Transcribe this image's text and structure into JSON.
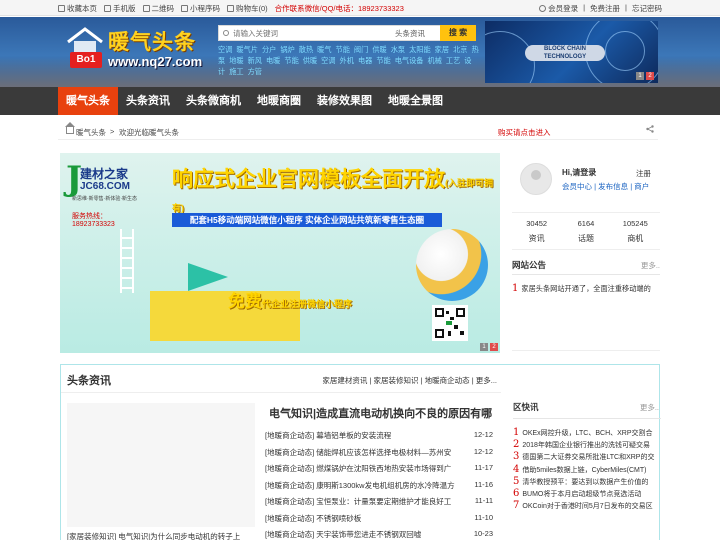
{
  "topbar": {
    "left": [
      "收藏本页",
      "手机版",
      "二维码",
      "小程序码",
      "购物车(0)"
    ],
    "hot": "合作联系微信/QQ/电话：18923733323",
    "right": [
      "会员登录",
      "免费注册",
      "忘记密码"
    ]
  },
  "header": {
    "logo_title": "暖气头条",
    "logo_badge": "Bo1",
    "logo_url": "www.nq27.com",
    "search_placeholder": "请输入关键词",
    "search_scope": "头条资讯",
    "search_button": "搜 索",
    "hot_words": [
      "空调",
      "暖气片",
      "分户",
      "锅炉",
      "散热",
      "暖气",
      "节能",
      "阀门",
      "供暖",
      "水泵",
      "太阳能",
      "家居",
      "北京",
      "热泵",
      "地暖",
      "新风",
      "电暖",
      "节能",
      "供暖",
      "空调",
      "外机",
      "电器",
      "节能",
      "电气设备",
      "机械",
      "工艺",
      "设计",
      "施工",
      "方管"
    ],
    "banner_label": "BLOCK CHAIN TECHNOLOGY",
    "banner_pages": [
      "1",
      "2"
    ]
  },
  "nav": [
    "暖气头条",
    "头条资讯",
    "头条微商机",
    "地暖商圈",
    "装修效果图",
    "地暖全景图"
  ],
  "crumb": {
    "home": "暖气头条",
    "sep": ">",
    "here": "欢迎光临暖气头条",
    "buy": "购买请点击进入"
  },
  "slide": {
    "logo_cn": "建材之家",
    "logo_url": "JC68.COM",
    "logo_motto": "新思维·新零售·新体验·新生态",
    "logo_phone": "服务热线：18923733323",
    "headline": "响应式企业官网模板全面开放",
    "headline_note": "(入驻即可拥有)",
    "sub": "配套H5移动端网站微信小程序 实体企业网站共筑新零售生态圈",
    "free": "免费",
    "free_note": "代企业注册微信小程序",
    "pages": [
      "1",
      "2"
    ]
  },
  "user": {
    "hi": "Hi,请登录",
    "register": "注册",
    "links": "会员中心 | 发布信息 | 商户"
  },
  "stats": [
    {
      "n": "30452",
      "l": "资讯"
    },
    {
      "n": "6164",
      "l": "话题"
    },
    {
      "n": "105245",
      "l": "商机"
    }
  ],
  "notice": {
    "title": "网站公告",
    "more": "更多..",
    "num": "1",
    "item": "家居头条网站开通了，全面注重移动端的"
  },
  "news": {
    "title": "头条资讯",
    "more": "家居建材资讯 | 家居装修知识 | 地暖商企动态 | 更多...",
    "lead": "电气知识|造成直流电动机换向不良的原因有哪",
    "caption": "[家居装修知识] 电气知识|为什么同步电动机的转子上",
    "items": [
      {
        "t": "[地暖商企动态] 幕墙铝单板的安装流程",
        "d": "12-12"
      },
      {
        "t": "[地暖商企动态] 储能焊机应该怎样选择电极材料—苏州安",
        "d": "12-12"
      },
      {
        "t": "[地暖商企动态] 燃煤锅炉在沈阳铁西地热安装市场得到广",
        "d": "11-17"
      },
      {
        "t": "[地暖商企动态] 康明斯1300kw发电机组机房的水冷降温方",
        "d": "11-16"
      },
      {
        "t": "[地暖商企动态] 宝恒泵业：计量泵要定期维护才能良好工",
        "d": "11-11"
      },
      {
        "t": "[地暖商企动态] 不锈钢喷砂板",
        "d": "11-10"
      },
      {
        "t": "[地暖商企动态] 天宇装饰带您进走不锈钢双回嘘",
        "d": "10-23"
      }
    ]
  },
  "flash": {
    "title": "区快讯",
    "more": "更多..",
    "items": [
      {
        "n": "1",
        "t": "OKEx网控升级，LTC、BCH、XRP交割合"
      },
      {
        "n": "2",
        "t": "2018年韩国企业银行推出的洗钱可疑交易"
      },
      {
        "n": "3",
        "t": "德国第二大证券交易所批准LTC和XRP的交"
      },
      {
        "n": "4",
        "t": "借助5miles数据上链，CyberMiles(CMT)"
      },
      {
        "n": "5",
        "t": "清华教授预平：要达到以数据产生价值的"
      },
      {
        "n": "6",
        "t": "BUMO将于本月启动超级节点竞选活动"
      },
      {
        "n": "7",
        "t": "OKCoin对于香港时间5月7日发布的交易区"
      }
    ]
  }
}
